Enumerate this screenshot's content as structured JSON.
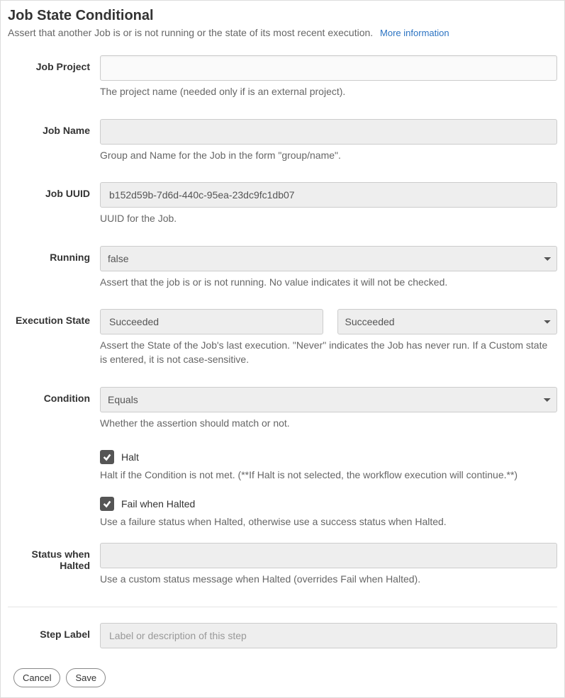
{
  "title": "Job State Conditional",
  "description": "Assert that another Job is or is not running or the state of its most recent execution.",
  "more_info_label": "More information",
  "fields": {
    "job_project": {
      "label": "Job Project",
      "value": "",
      "help": "The project name (needed only if is an external project)."
    },
    "job_name": {
      "label": "Job Name",
      "value": "",
      "help": "Group and Name for the Job in the form \"group/name\"."
    },
    "job_uuid": {
      "label": "Job UUID",
      "value": "b152d59b-7d6d-440c-95ea-23dc9fc1db07",
      "help": "UUID for the Job."
    },
    "running": {
      "label": "Running",
      "value": "false",
      "help": "Assert that the job is or is not running. No value indicates it will not be checked."
    },
    "execution_state": {
      "label": "Execution State",
      "input_value": "Succeeded",
      "select_value": "Succeeded",
      "help": "Assert the State of the Job's last execution. \"Never\" indicates the Job has never run. If a Custom state is entered, it is not case-sensitive."
    },
    "condition": {
      "label": "Condition",
      "value": "Equals",
      "help": "Whether the assertion should match or not."
    },
    "halt": {
      "label": "Halt",
      "checked": true,
      "help": "Halt if the Condition is not met. (**If Halt is not selected, the workflow execution will continue.**)"
    },
    "fail_when_halted": {
      "label": "Fail when Halted",
      "checked": true,
      "help": "Use a failure status when Halted, otherwise use a success status when Halted."
    },
    "status_when_halted": {
      "label": "Status when Halted",
      "value": "",
      "help": "Use a custom status message when Halted (overrides Fail when Halted)."
    },
    "step_label": {
      "label": "Step Label",
      "placeholder": "Label or description of this step",
      "value": ""
    }
  },
  "buttons": {
    "cancel": "Cancel",
    "save": "Save"
  }
}
